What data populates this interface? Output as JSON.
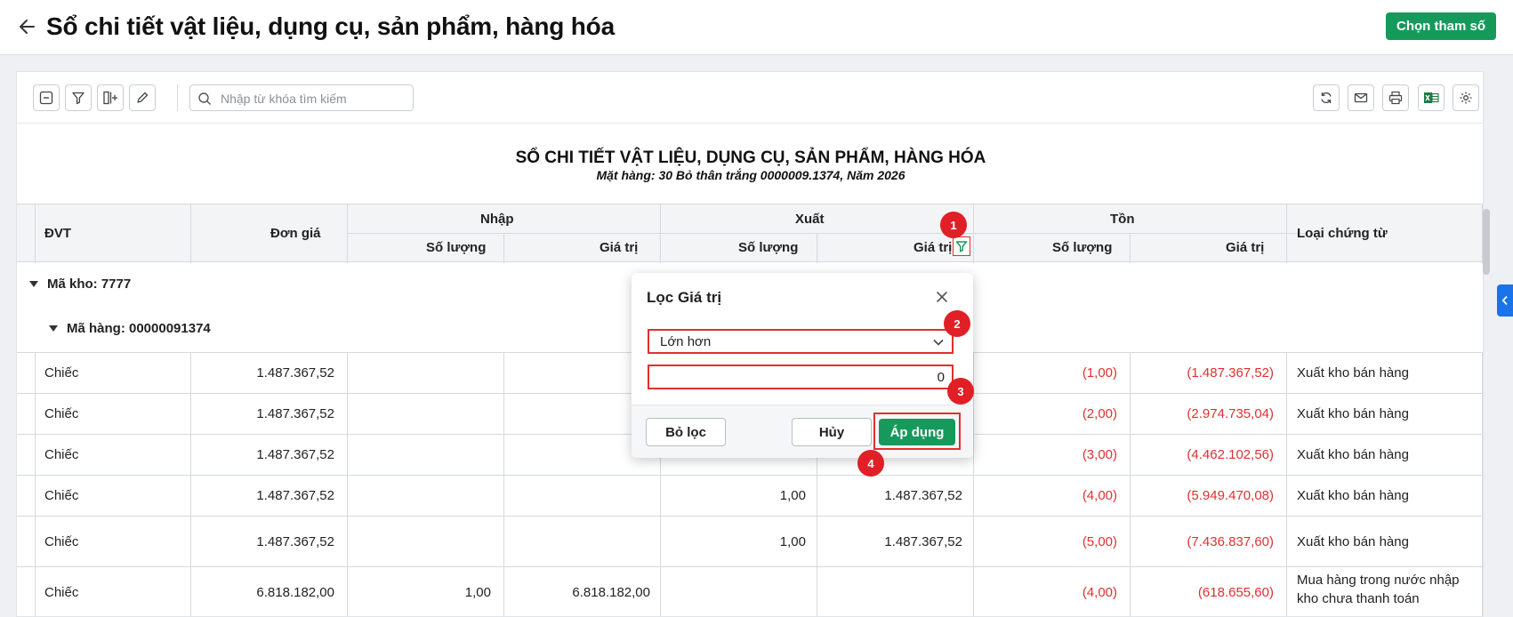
{
  "header": {
    "title": "Sổ chi tiết vật liệu, dụng cụ, sản phẩm, hàng hóa",
    "choose_params_label": "Chọn tham số"
  },
  "toolbar": {
    "search_placeholder": "Nhập từ khóa tìm kiếm",
    "left_icons": [
      "collapse-icon",
      "filter-icon",
      "add-column-icon",
      "edit-icon"
    ],
    "right_icons": [
      "refresh-icon",
      "mail-icon",
      "print-icon",
      "excel-icon",
      "settings-icon"
    ]
  },
  "report": {
    "title": "SỔ CHI TIẾT VẬT LIỆU, DỤNG CỤ, SẢN PHẨM, HÀNG HÓA",
    "subtitle": "Mặt hàng: 30 Bỏ thân trắng 0000009.1374, Năm 2026"
  },
  "table": {
    "headers": {
      "dvt": "ĐVT",
      "don_gia": "Đơn giá",
      "nhap": "Nhập",
      "xuat": "Xuất",
      "ton": "Tồn",
      "so_luong": "Số lượng",
      "gia_tri": "Giá trị",
      "loai_chung_tu": "Loại chứng từ"
    },
    "groups": {
      "kho": "Mã kho: 7777",
      "hang": "Mã hàng: 00000091374"
    },
    "rows": [
      {
        "dvt": "Chiếc",
        "don_gia": "1.487.367,52",
        "nhap_sl": "",
        "nhap_gt": "",
        "xuat_sl": "",
        "xuat_gt": "",
        "ton_sl": "(1,00)",
        "ton_gt": "(1.487.367,52)",
        "loai": "Xuất kho bán hàng"
      },
      {
        "dvt": "Chiếc",
        "don_gia": "1.487.367,52",
        "nhap_sl": "",
        "nhap_gt": "",
        "xuat_sl": "",
        "xuat_gt": "",
        "ton_sl": "(2,00)",
        "ton_gt": "(2.974.735,04)",
        "loai": "Xuất kho bán hàng"
      },
      {
        "dvt": "Chiếc",
        "don_gia": "1.487.367,52",
        "nhap_sl": "",
        "nhap_gt": "",
        "xuat_sl": "",
        "xuat_gt": "",
        "ton_sl": "(3,00)",
        "ton_gt": "(4.462.102,56)",
        "loai": "Xuất kho bán hàng"
      },
      {
        "dvt": "Chiếc",
        "don_gia": "1.487.367,52",
        "nhap_sl": "",
        "nhap_gt": "",
        "xuat_sl": "1,00",
        "xuat_gt": "1.487.367,52",
        "ton_sl": "(4,00)",
        "ton_gt": "(5.949.470,08)",
        "loai": "Xuất kho bán hàng"
      },
      {
        "dvt": "Chiếc",
        "don_gia": "1.487.367,52",
        "nhap_sl": "",
        "nhap_gt": "",
        "xuat_sl": "1,00",
        "xuat_gt": "1.487.367,52",
        "ton_sl": "(5,00)",
        "ton_gt": "(7.436.837,60)",
        "loai": "Xuất kho bán hàng"
      },
      {
        "dvt": "Chiếc",
        "don_gia": "6.818.182,00",
        "nhap_sl": "1,00",
        "nhap_gt": "6.818.182,00",
        "xuat_sl": "",
        "xuat_gt": "",
        "ton_sl": "(4,00)",
        "ton_gt": "(618.655,60)",
        "loai": "Mua hàng trong nước nhập kho chưa thanh toán"
      }
    ]
  },
  "popup": {
    "title": "Lọc Giá trị",
    "operator": "Lớn hơn",
    "value": "0",
    "clear_label": "Bỏ lọc",
    "cancel_label": "Hủy",
    "apply_label": "Áp dụng"
  },
  "badges": [
    "1",
    "2",
    "3",
    "4"
  ],
  "colors": {
    "primary": "#159a5b",
    "negative": "#e0302f",
    "annotation": "#e01f26",
    "side_tab": "#1a73e8"
  }
}
